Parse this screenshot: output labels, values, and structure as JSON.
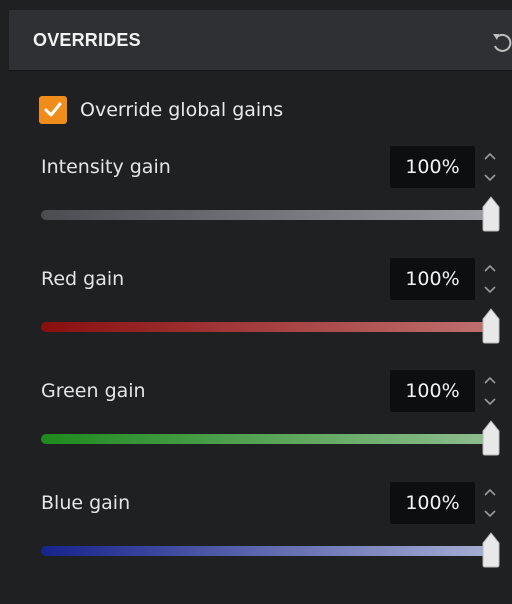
{
  "header": {
    "title": "OVERRIDES",
    "reset_icon": "reset-icon"
  },
  "override": {
    "checked": true,
    "label": "Override global gains"
  },
  "gains": [
    {
      "id": "intensity",
      "label": "Intensity gain",
      "value": "100%",
      "level": 1.0,
      "colors": [
        "#4a4c50",
        "#9a9ca1"
      ]
    },
    {
      "id": "red",
      "label": "Red gain",
      "value": "100%",
      "level": 1.0,
      "colors": [
        "#8a0e0e",
        "#c07070"
      ]
    },
    {
      "id": "green",
      "label": "Green gain",
      "value": "100%",
      "level": 1.0,
      "colors": [
        "#1e8a1e",
        "#8fbd8f"
      ]
    },
    {
      "id": "blue",
      "label": "Blue gain",
      "value": "100%",
      "level": 1.0,
      "colors": [
        "#16238a",
        "#a7afd4"
      ]
    }
  ],
  "colors": {
    "accent": "#f08c1a",
    "header_bg": "#2f3033",
    "panel_bg": "#1f2022"
  }
}
